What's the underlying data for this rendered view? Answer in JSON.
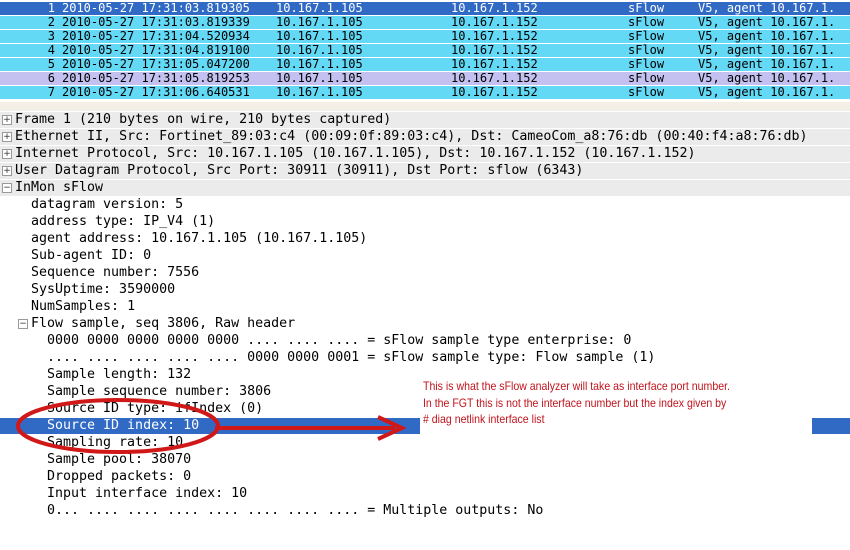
{
  "packet_list": {
    "rows": [
      {
        "no": "1",
        "time": "2010-05-27 17:31:03.819305",
        "source": "10.167.1.105",
        "destination": "10.167.1.152",
        "protocol": "sFlow",
        "info": "V5, agent 10.167.1.",
        "state": "selected"
      },
      {
        "no": "2",
        "time": "2010-05-27 17:31:03.819339",
        "source": "10.167.1.105",
        "destination": "10.167.1.152",
        "protocol": "sFlow",
        "info": "V5, agent 10.167.1.",
        "state": "normal"
      },
      {
        "no": "3",
        "time": "2010-05-27 17:31:04.520934",
        "source": "10.167.1.105",
        "destination": "10.167.1.152",
        "protocol": "sFlow",
        "info": "V5, agent 10.167.1.",
        "state": "normal"
      },
      {
        "no": "4",
        "time": "2010-05-27 17:31:04.819100",
        "source": "10.167.1.105",
        "destination": "10.167.1.152",
        "protocol": "sFlow",
        "info": "V5, agent 10.167.1.",
        "state": "normal"
      },
      {
        "no": "5",
        "time": "2010-05-27 17:31:05.047200",
        "source": "10.167.1.105",
        "destination": "10.167.1.152",
        "protocol": "sFlow",
        "info": "V5, agent 10.167.1.",
        "state": "normal"
      },
      {
        "no": "6",
        "time": "2010-05-27 17:31:05.819253",
        "source": "10.167.1.105",
        "destination": "10.167.1.152",
        "protocol": "sFlow",
        "info": "V5, agent 10.167.1.",
        "state": "marked"
      },
      {
        "no": "7",
        "time": "2010-05-27 17:31:06.640531",
        "source": "10.167.1.105",
        "destination": "10.167.1.152",
        "protocol": "sFlow",
        "info": "V5, agent 10.167.1.",
        "state": "normal"
      }
    ]
  },
  "detail": {
    "lines": [
      {
        "text": "Frame 1 (210 bytes on wire, 210 bytes captured)",
        "level": 0,
        "expander": "+"
      },
      {
        "text": "Ethernet II, Src: Fortinet_89:03:c4 (00:09:0f:89:03:c4), Dst: CameoCom_a8:76:db (00:40:f4:a8:76:db)",
        "level": 0,
        "expander": "+"
      },
      {
        "text": "Internet Protocol, Src: 10.167.1.105 (10.167.1.105), Dst: 10.167.1.152 (10.167.1.152)",
        "level": 0,
        "expander": "+"
      },
      {
        "text": "User Datagram Protocol, Src Port: 30911 (30911), Dst Port: sflow (6343)",
        "level": 0,
        "expander": "+"
      },
      {
        "text": "InMon sFlow",
        "level": 0,
        "expander": "-"
      },
      {
        "text": "datagram version: 5",
        "level": 1
      },
      {
        "text": "address type: IP_V4 (1)",
        "level": 1
      },
      {
        "text": "agent address: 10.167.1.105 (10.167.1.105)",
        "level": 1
      },
      {
        "text": "Sub-agent ID: 0",
        "level": 1
      },
      {
        "text": "Sequence number: 7556",
        "level": 1
      },
      {
        "text": "SysUptime: 3590000",
        "level": 1
      },
      {
        "text": "NumSamples: 1",
        "level": 1
      },
      {
        "text": "Flow sample, seq 3806, Raw header",
        "level": 1,
        "expander": "-"
      },
      {
        "text": "0000 0000 0000 0000 0000 .... .... .... = sFlow sample type enterprise: 0",
        "level": 2
      },
      {
        "text": ".... .... .... .... .... 0000 0000 0001 = sFlow sample type: Flow sample (1)",
        "level": 2
      },
      {
        "text": "Sample length: 132",
        "level": 2
      },
      {
        "text": "Sample sequence number: 3806",
        "level": 2
      },
      {
        "text": "Source ID type: ifIndex (0)",
        "level": 2
      },
      {
        "text": "Source ID index: 10",
        "level": 2,
        "highlight": true
      },
      {
        "text": "Sampling rate: 10",
        "level": 2
      },
      {
        "text": "Sample pool: 38070",
        "level": 2
      },
      {
        "text": "Dropped packets: 0",
        "level": 2
      },
      {
        "text": "Input interface index: 10",
        "level": 2
      },
      {
        "text": "0... .... .... .... .... .... .... .... = Multiple outputs: No",
        "level": 2
      }
    ]
  },
  "annotation": {
    "lines": [
      "This is what the sFlow analyzer will take as interface port number.",
      "In the FGT this is not the interface number but the index given by",
      "# diag netlink interface list"
    ],
    "color": "#c0141c"
  },
  "colors": {
    "row_selected": "#316ac5",
    "row_normal": "#63d9f5",
    "row_marked": "#c4c0f0"
  }
}
